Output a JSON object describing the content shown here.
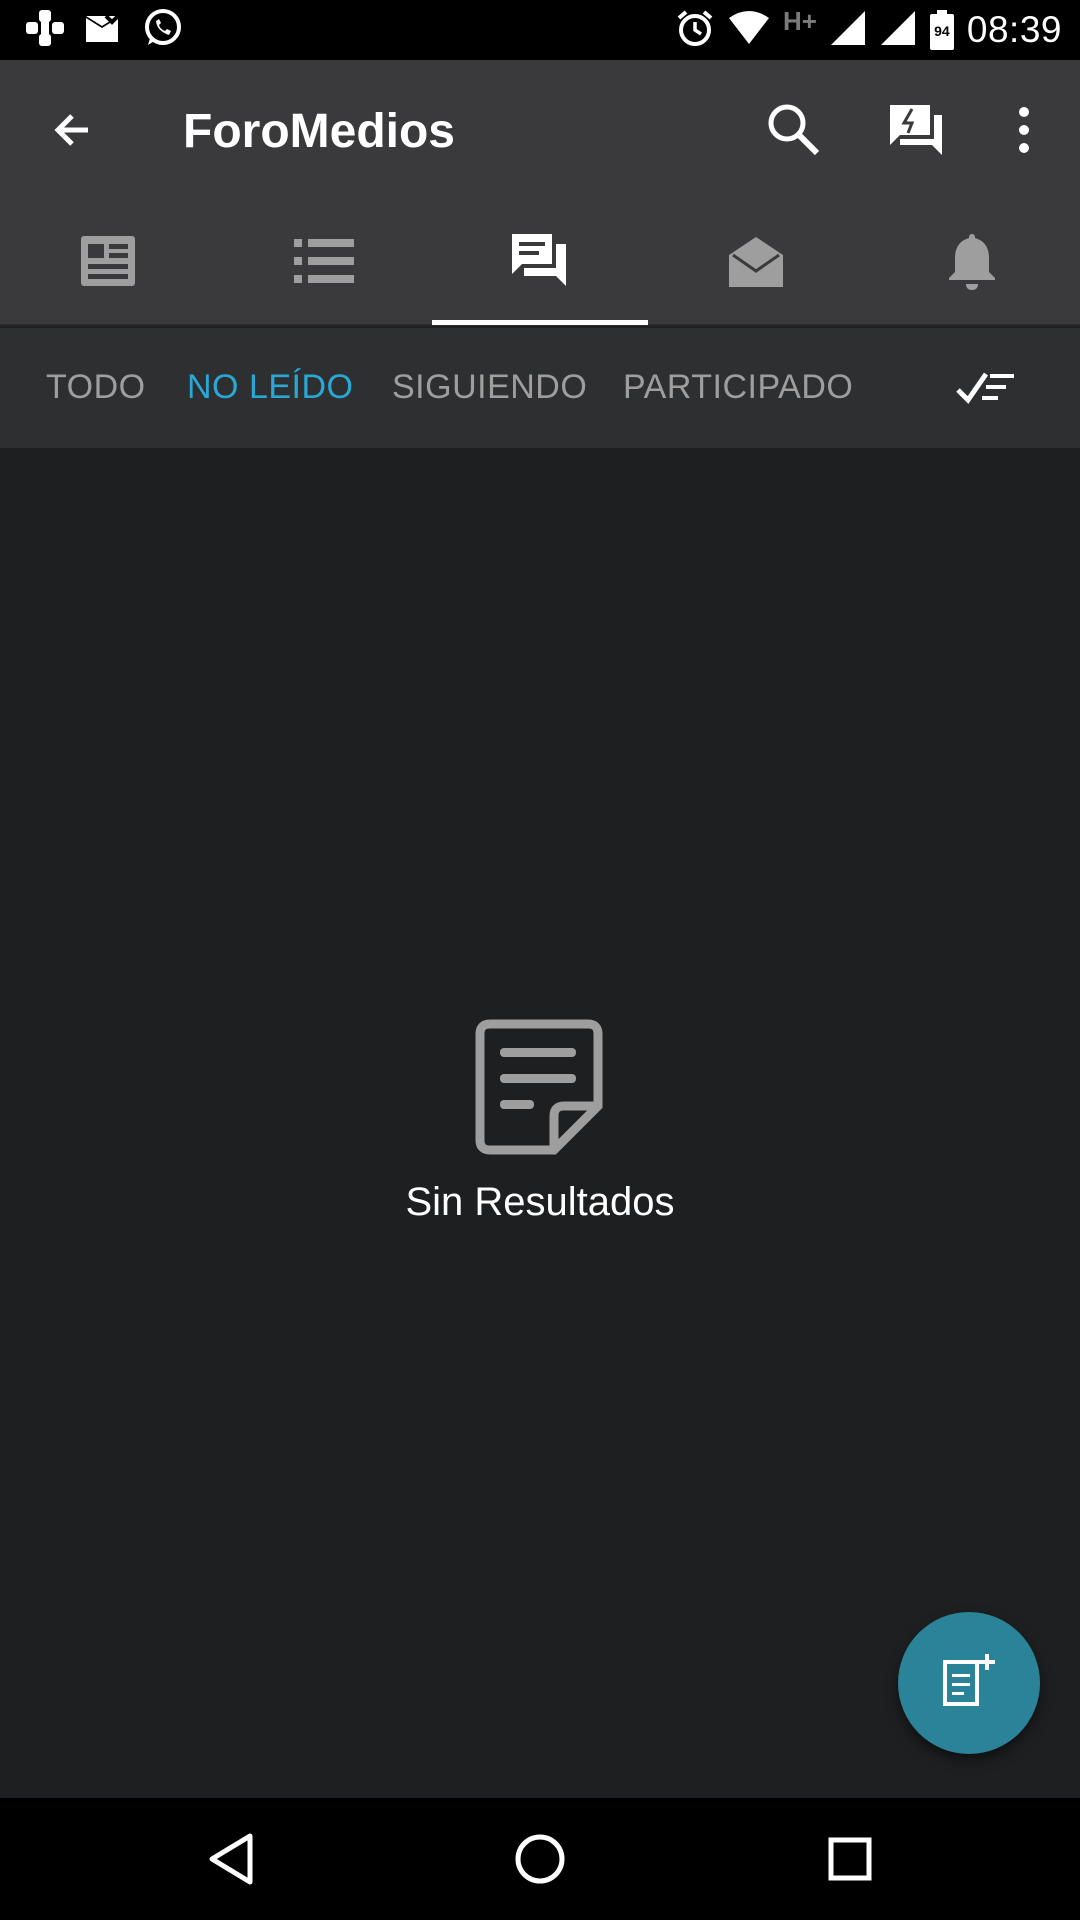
{
  "status_bar": {
    "time": "08:39",
    "network_type": "H+",
    "battery_level": "94",
    "icons": [
      "game-controller-icon",
      "mail-check-icon",
      "whatsapp-icon",
      "alarm-icon",
      "wifi-icon",
      "signal-icon",
      "signal-icon",
      "battery-icon"
    ]
  },
  "app_bar": {
    "title": "ForoMedios",
    "back_icon": "arrow-back-icon",
    "actions": [
      "search-icon",
      "forum-alert-icon",
      "more-vert-icon"
    ]
  },
  "tabs": [
    {
      "icon": "newspaper-icon",
      "active": false
    },
    {
      "icon": "list-icon",
      "active": false
    },
    {
      "icon": "forum-icon",
      "active": true
    },
    {
      "icon": "drafts-icon",
      "active": false
    },
    {
      "icon": "bell-icon",
      "active": false
    }
  ],
  "filters": [
    {
      "label": "TODO",
      "active": false
    },
    {
      "label": "NO LEÍDO",
      "active": true
    },
    {
      "label": "SIGUIENDO",
      "active": false
    },
    {
      "label": "PARTICIPADO",
      "active": false
    }
  ],
  "mark_all_read_icon": "checklist-icon",
  "empty_state": {
    "icon": "note-icon",
    "text": "Sin Resultados"
  },
  "fab": {
    "icon": "new-post-icon"
  },
  "nav_bar": [
    "back-triangle-icon",
    "home-circle-icon",
    "recents-square-icon"
  ],
  "colors": {
    "accent": "#29a8d6",
    "fab": "#2b8399",
    "app_bar": "#3a3a3c",
    "filter_bar": "#2e2f31",
    "background": "#1e1f21"
  }
}
